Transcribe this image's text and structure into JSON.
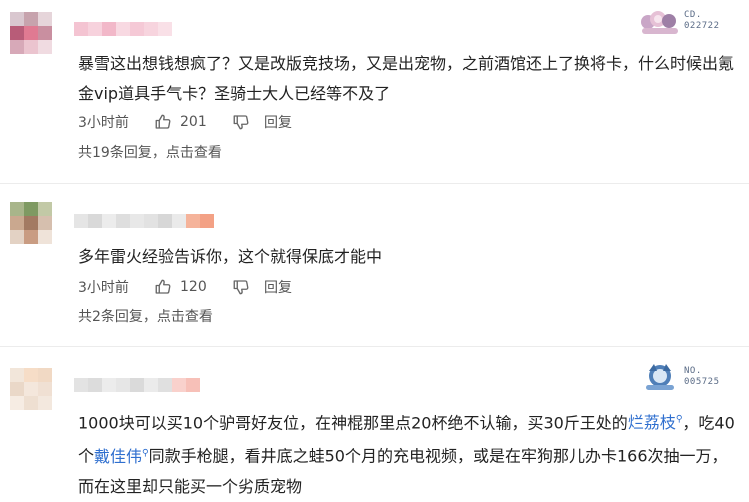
{
  "comments": [
    {
      "text": "暴雪这出想钱想疯了？又是改版竞技场，又是出宠物，之前酒馆还上了换将卡，什么时候出氪金vip道具手气卡？圣骑士大人已经等不及了",
      "time": "3小时前",
      "likes": "201",
      "reply_label": "回复",
      "replies_link": "共19条回复，点击查看",
      "badge": {
        "label": "CD.",
        "number": "022722",
        "icon": "anime-fan-badge-icon"
      }
    },
    {
      "text": "多年雷火经验告诉你，这个就得保底才能中",
      "time": "3小时前",
      "likes": "120",
      "reply_label": "回复",
      "replies_link": "共2条回复，点击查看"
    },
    {
      "text_parts": [
        "1000块可以买10个驴哥好友位，在神棍那里点20杯绝不认输，买30斤王处的",
        "烂荔枝",
        "，吃40个",
        "戴佳伟",
        "同款手枪腿，看井底之蛙50个月的充电视频，或是在牢狗那儿办卡166次抽一万，而在这里却只能买一个劣质宠物"
      ],
      "badge": {
        "label": "NO.",
        "number": "005725",
        "icon": "anime-fan-badge-icon"
      }
    }
  ],
  "colors": {
    "link": "#2f6fcf",
    "meta": "#555555",
    "text": "#222222"
  }
}
